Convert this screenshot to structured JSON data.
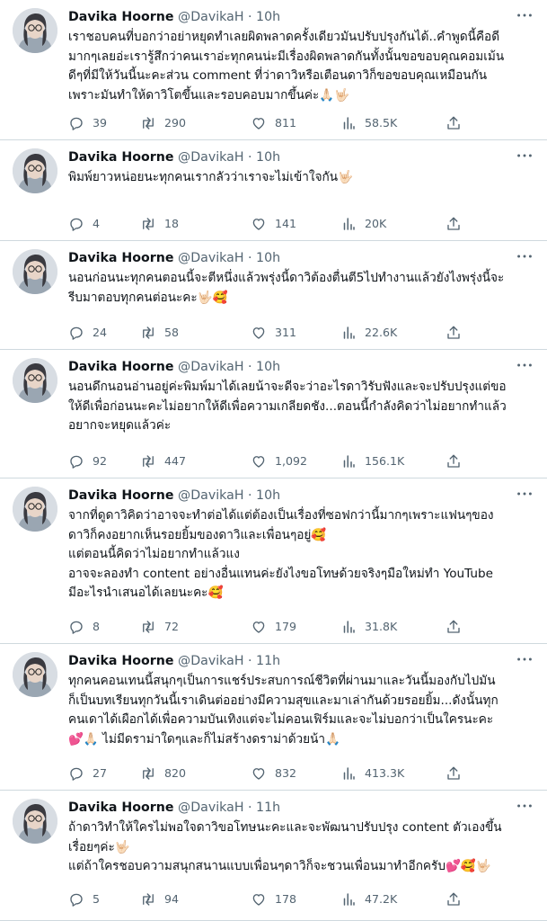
{
  "profile": {
    "name": "Davika Hoorne",
    "handle": "@DavikaH"
  },
  "tweets": [
    {
      "time": "10h",
      "lines": [
        "เราชอบคนที่บอกว่าอย่าหยุดทำเลยผิดพลาดครั้งเดียวมันปรับปรุงกันได้..คำพูดนี้คือดี",
        "มากๆเลยอ่ะเรารู้สึกว่าคนเราอ่ะทุกคนน่ะมีเรื่องผิดพลาดกันทั้งนั้นขอขอบคุณคอมเม้น",
        "ดีๆที่มีให้วันนี้นะคะส่วน comment ที่ว่าดาวิหรือเตือนดาวิก็ขอขอบคุณเหมือนกัน",
        "เพราะมันทำให้ดาวิโตขึ้นและรอบคอบมากขึ้นค่ะ🙏🏻🤟🏻"
      ],
      "replies": "39",
      "retweets": "290",
      "likes": "811",
      "views": "58.5K"
    },
    {
      "time": "10h",
      "lines": [
        "พิมพ์ยาวหน่อยนะทุกคนเรากลัวว่าเราจะไม่เข้าใจกัน🤟🏻"
      ],
      "replies": "4",
      "retweets": "18",
      "likes": "141",
      "views": "20K"
    },
    {
      "time": "10h",
      "lines": [
        "นอนก่อนนะทุกคนตอนนี้จะตีหนึ่งแล้วพรุ่งนี้ดาวิต้องตื่นตี5ไปทำงานแล้วยังไงพรุ่งนี้จะ",
        "รีบมาตอบทุกคนต่อนะคะ🤟🏻🥰"
      ],
      "replies": "24",
      "retweets": "58",
      "likes": "311",
      "views": "22.6K"
    },
    {
      "time": "10h",
      "lines": [
        "นอนดึกนอนอ่านอยู่ค่ะพิมพ์มาได้เลยน้าจะดีจะว่าอะไรดาวิรับฟังและจะปรับปรุงแต่ขอ",
        "ให้ดีเพื่อก่อนนะคะไม่อยากให้ดีเพื่อความเกลียดชัง...ตอนนี้กำลังคิดว่าไม่อยากทำแล้ว",
        "อยากจะหยุดแล้วค่ะ"
      ],
      "replies": "92",
      "retweets": "447",
      "likes": "1,092",
      "views": "156.1K"
    },
    {
      "time": "10h",
      "lines": [
        "จากที่ดูดาวิคิดว่าอาจจะทำต่อได้แต่ต้องเป็นเรื่องที่ซอฟกว่านี้มากๆเพราะแฟนๆของ",
        "ดาวิก็คงอยากเห็นรอยยิ้มของดาวิและเพื่อนๆอยู่🥰",
        "แต่ตอนนี้คิดว่าไม่อยากทำแล้วแง",
        "อาจจะลองทำ content อย่างอื่นแทนค่ะยังไงขอโทษด้วยจริงๆมือใหม่ทำ YouTube",
        "มีอะไรนำเสนอได้เลยนะคะ🥰"
      ],
      "replies": "8",
      "retweets": "72",
      "likes": "179",
      "views": "31.8K"
    },
    {
      "time": "11h",
      "lines": [
        "ทุกคนคอนเทนนี้สนุกๆเป็นการแชร์ประสบการณ์ชีวิตที่ผ่านมาและวันนี้มองกับไปมัน",
        "ก็เป็นบทเรียนทุกวันนี้เราเดินต่ออย่างมีความสุขและมาเล่ากันด้วยรอยยิ้ม...ดังนั้นทุก",
        "คนเดาได้เผือกได้เพื่อความบันเทิงแต่จะไม่คอนเฟิร์มและจะไม่บอกว่าเป็นใครนะคะ",
        "💕🙏🏻 ไม่มีดราม่าใดๆและก็ไม่สร้างดราม่าด้วยน้า🙏🏻"
      ],
      "replies": "27",
      "retweets": "820",
      "likes": "832",
      "views": "413.3K"
    },
    {
      "time": "11h",
      "lines": [
        "ถ้าดาวิทำให้ใครไม่พอใจดาวิขอโทษนะคะและจะพัฒนาปรับปรุง content ตัวเองขึ้น",
        "เรื่อยๆค่ะ🤟🏻",
        "แต่ถ้าใครชอบความสนุกสนานแบบเพื่อนๆดาวิก็จะชวนเพื่อนมาทำอีกครับ💕🥰🤟🏻"
      ],
      "replies": "5",
      "retweets": "94",
      "likes": "178",
      "views": "47.2K"
    }
  ],
  "icons": {
    "reply": "reply-icon",
    "retweet": "retweet-icon",
    "like": "heart-icon",
    "views": "views-chart-icon",
    "share": "share-icon",
    "more": "more-dots-icon"
  },
  "colors": {
    "text": "#0f1419",
    "secondary": "#536471",
    "divider": "#cfd9de"
  }
}
